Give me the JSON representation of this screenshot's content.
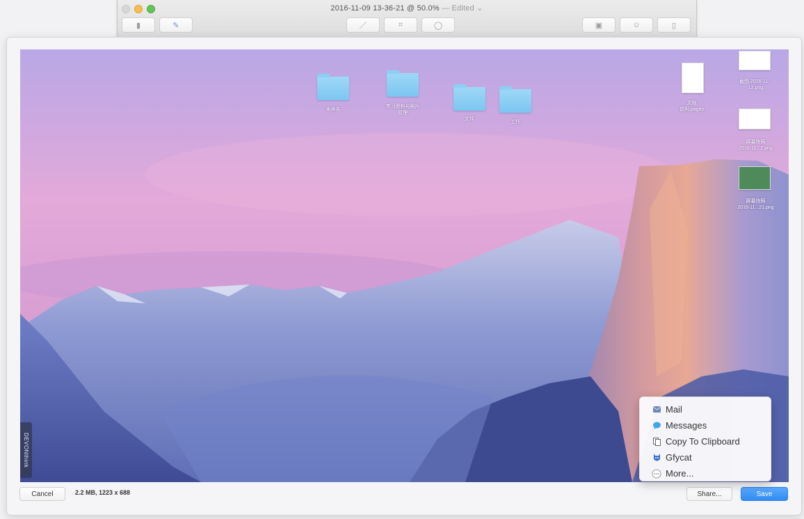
{
  "window": {
    "title": "2016-11-09 13-36-21 @ 50.0%",
    "edited_suffix": "— Edited ⌄"
  },
  "desktop": {
    "folders": [
      {
        "label": "未命名"
      },
      {
        "label": "学习资料与照片\n管理"
      },
      {
        "label": "文件"
      },
      {
        "label": "工作"
      }
    ],
    "files": [
      {
        "label": "截图 2016-11...\n12.png"
      },
      {
        "label": "文档\n说明.pages"
      },
      {
        "label": "屏幕快照\n2016-11...2.png"
      },
      {
        "label": "屏幕快照\n2016-11...21.png"
      }
    ],
    "watermark": "DEVONthink"
  },
  "share_menu": {
    "items": [
      {
        "label": "Mail",
        "icon": "mail-icon"
      },
      {
        "label": "Messages",
        "icon": "messages-icon"
      },
      {
        "label": "Copy To Clipboard",
        "icon": "clipboard-icon"
      },
      {
        "label": "Gfycat",
        "icon": "gfycat-icon"
      },
      {
        "label": "More...",
        "icon": "more-icon"
      }
    ]
  },
  "bottom": {
    "cancel_label": "Cancel",
    "info": "2.2 MB, 1223 x 688",
    "share_label": "Share...",
    "save_label": "Save"
  },
  "colors": {
    "accent": "#2f8bf3",
    "traffic_close": "#d7d7d7",
    "traffic_min": "#f5bf4f",
    "traffic_max": "#62c554"
  }
}
